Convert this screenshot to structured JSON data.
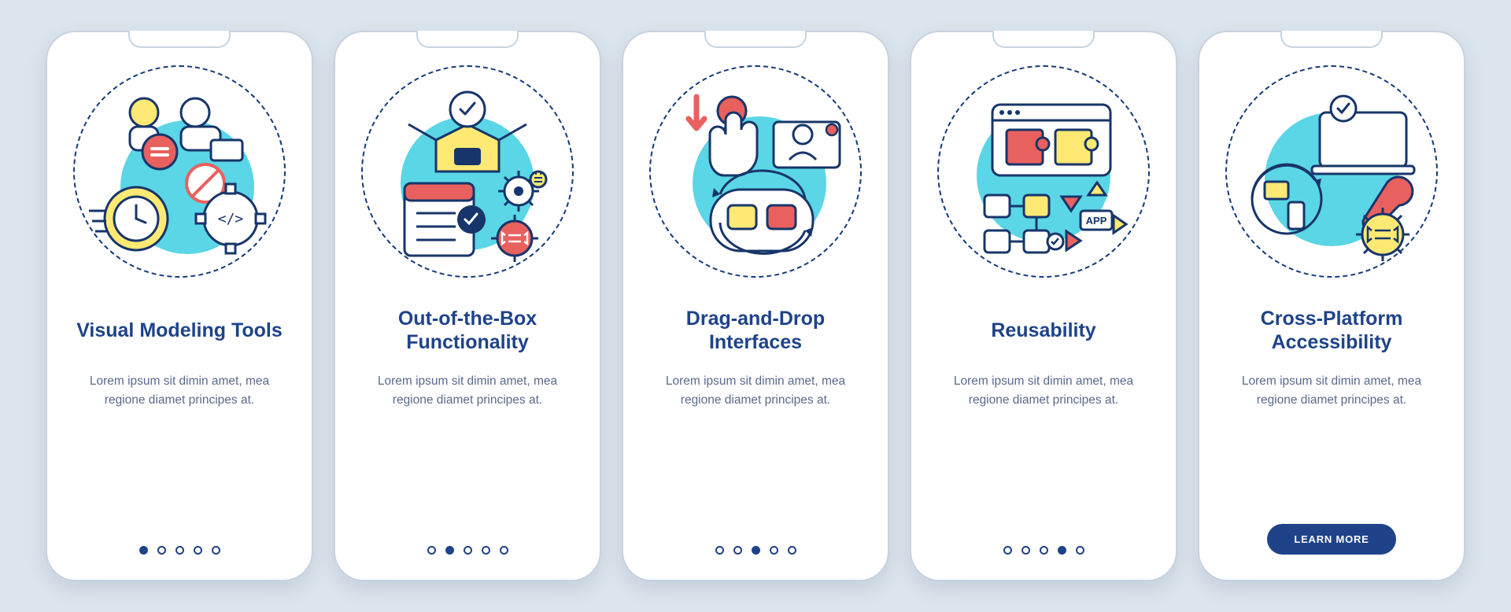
{
  "dot_count": 5,
  "cards": [
    {
      "title": "Visual Modeling Tools",
      "desc": "Lorem ipsum sit dimin amet, mea regione diamet principes at.",
      "active_index": 0,
      "has_cta": false
    },
    {
      "title": "Out-of-the-Box Functionality",
      "desc": "Lorem ipsum sit dimin amet, mea regione diamet principes at.",
      "active_index": 1,
      "has_cta": false
    },
    {
      "title": "Drag-and-Drop Interfaces",
      "desc": "Lorem ipsum sit dimin amet, mea regione diamet principes at.",
      "active_index": 2,
      "has_cta": false
    },
    {
      "title": "Reusability",
      "desc": "Lorem ipsum sit dimin amet, mea regione diamet principes at.",
      "active_index": 3,
      "has_cta": false
    },
    {
      "title": "Cross-Platform Accessibility",
      "desc": "Lorem ipsum sit dimin amet, mea regione diamet principes at.",
      "active_index": 4,
      "has_cta": true
    }
  ],
  "cta_label": "LEARN MORE",
  "colors": {
    "background": "#dbe5ed",
    "card": "#ffffff",
    "heading": "#1e4388",
    "body_text": "#5a6a8c",
    "accent_teal": "#5ad6e6",
    "accent_yellow": "#fde974",
    "accent_red": "#e8615e"
  },
  "icons": [
    "visual-modeling-icon",
    "out-of-the-box-icon",
    "drag-and-drop-icon",
    "reusability-icon",
    "cross-platform-icon"
  ]
}
